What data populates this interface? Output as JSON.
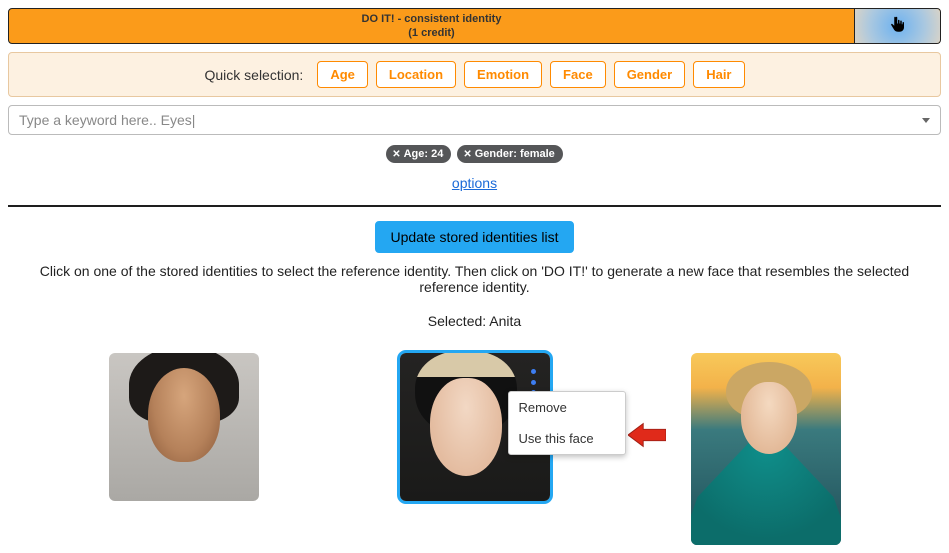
{
  "top_bar": {
    "title": "DO IT! - consistent identity",
    "credit": "(1 credit)"
  },
  "quick": {
    "label": "Quick selection:",
    "chips": [
      "Age",
      "Location",
      "Emotion",
      "Face",
      "Gender",
      "Hair"
    ]
  },
  "keyword_placeholder": "Type a keyword here.. Eyes|",
  "tags": [
    {
      "label": "Age: 24"
    },
    {
      "label": "Gender: female"
    }
  ],
  "options_link": "options",
  "update_button": "Update stored identities list",
  "instruction": "Click on one of the stored identities to select the reference identity. Then click on 'DO IT!' to generate a new face that resembles the selected reference identity.",
  "selected_prefix": "Selected: ",
  "selected_name": "Anita",
  "context_menu": {
    "remove": "Remove",
    "use_face": "Use this face"
  }
}
